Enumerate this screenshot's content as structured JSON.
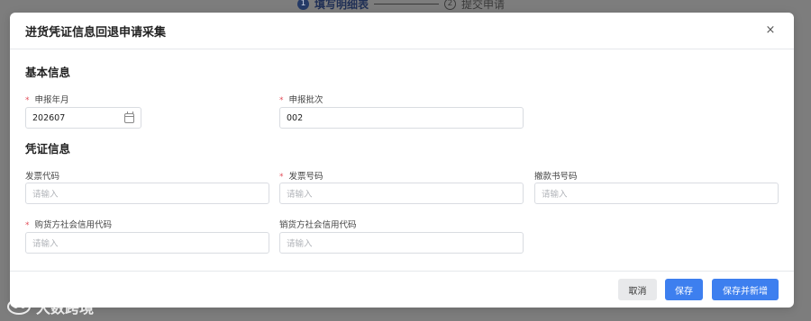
{
  "background": {
    "steps": [
      {
        "number": "1",
        "label": "填写明细表",
        "active": true
      },
      {
        "number": "2",
        "label": "提交申请",
        "active": false
      }
    ],
    "watermark": "大数跨境"
  },
  "dialog": {
    "title": "进货凭证信息回退申请采集",
    "close_glyph": "×",
    "sections": {
      "basic": {
        "title": "基本信息",
        "fields": [
          {
            "label": "申报年月",
            "required": true,
            "value": "202607",
            "placeholder": ""
          },
          {
            "label": "申报批次",
            "required": true,
            "value": "002",
            "placeholder": ""
          }
        ]
      },
      "voucher": {
        "title": "凭证信息",
        "fields": [
          {
            "label": "发票代码",
            "required": false,
            "value": "",
            "placeholder": "请输入"
          },
          {
            "label": "发票号码",
            "required": true,
            "value": "",
            "placeholder": "请输入"
          },
          {
            "label": "撤款书号码",
            "required": false,
            "value": "",
            "placeholder": "请输入"
          },
          {
            "label": "购货方社会信用代码",
            "required": true,
            "value": "",
            "placeholder": "请输入"
          },
          {
            "label": "销货方社会信用代码",
            "required": false,
            "value": "",
            "placeholder": "请输入"
          }
        ]
      }
    },
    "required_mark": "*",
    "footer": {
      "cancel_label": "取消",
      "save_label": "保存",
      "save_new_label": "保存并新增"
    }
  }
}
